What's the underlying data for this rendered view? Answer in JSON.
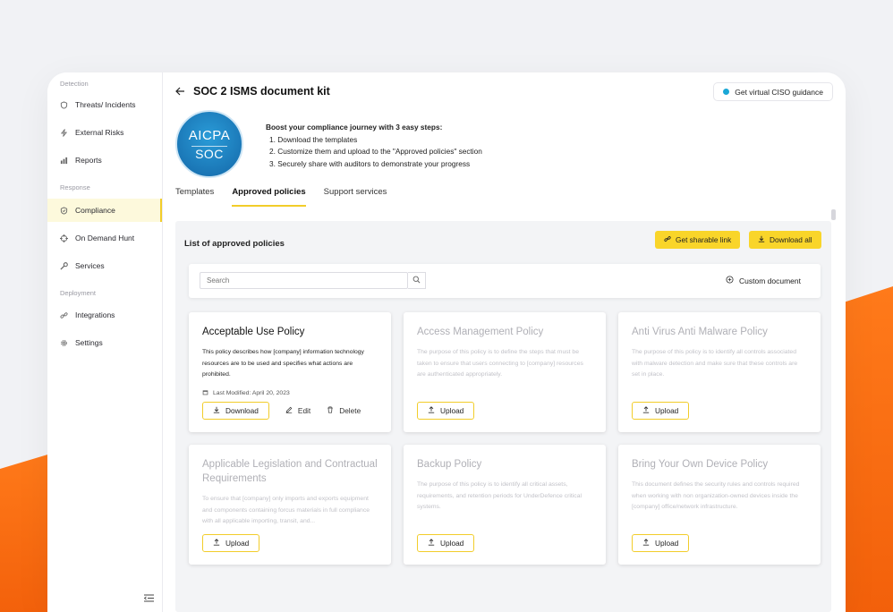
{
  "sidebar": {
    "sections": [
      {
        "label": "Detection",
        "items": [
          {
            "label": "Threats/ Incidents",
            "icon": "shield-icon"
          },
          {
            "label": "External Risks",
            "icon": "bolt-icon"
          },
          {
            "label": "Reports",
            "icon": "chart-icon"
          }
        ]
      },
      {
        "label": "Response",
        "items": [
          {
            "label": "Compliance",
            "icon": "check-shield-icon",
            "active": true
          },
          {
            "label": "On Demand Hunt",
            "icon": "crosshair-icon"
          },
          {
            "label": "Services",
            "icon": "wrench-icon"
          }
        ]
      },
      {
        "label": "Deployment",
        "items": [
          {
            "label": "Integrations",
            "icon": "link-icon"
          },
          {
            "label": "Settings",
            "icon": "gear-icon"
          }
        ]
      }
    ]
  },
  "header": {
    "title": "SOC 2 ISMS document kit",
    "ciso_label": "Get virtual CISO guidance"
  },
  "logo": {
    "line1": "AICPA",
    "line2": "SOC"
  },
  "steps": {
    "heading": "Boost your compliance journey with 3 easy steps:",
    "items": [
      "1. Download the templates",
      "2. Customize them and upload to the \"Approved policies\" section",
      "3. Securely share with auditors to demonstrate your progress"
    ]
  },
  "tabs": [
    "Templates",
    "Approved policies",
    "Support services"
  ],
  "list": {
    "title": "List of approved policies",
    "sharable_label": "Get sharable link",
    "download_all_label": "Download all",
    "search_placeholder": "Search",
    "custom_doc_label": "Custom document"
  },
  "cards": [
    {
      "title": "Acceptable Use Policy",
      "desc": "This policy describes how [company] information technology resources are to be used and specifies what actions are prohibited.",
      "modified": "Last Modified: April 20, 2023",
      "download": "Download",
      "edit": "Edit",
      "delete": "Delete",
      "disabled": false
    },
    {
      "title": "Access Management Policy",
      "desc": "The purpose of this policy is to define the steps that must be taken to ensure that users connecting to [company] resources are authenticated appropriately.",
      "upload": "Upload",
      "disabled": true
    },
    {
      "title": "Anti Virus Anti Malware Policy",
      "desc": "The purpose of this policy is to identify all controls associated with malware detection and make sure that these controls are set in place.",
      "upload": "Upload",
      "disabled": true
    },
    {
      "title": "Applicable Legislation and Contractual Requirements",
      "desc": "To ensure that [company] only imports and exports equipment and components containing forcus materials in full compliance with all applicable importing, transit, and...",
      "upload": "Upload",
      "disabled": true
    },
    {
      "title": "Backup Policy",
      "desc": "The purpose of this policy is to identify all critical assets, requirements, and retention periods for UnderDefence critical systems.",
      "upload": "Upload",
      "disabled": true
    },
    {
      "title": "Bring Your Own Device Policy",
      "desc": "This document defines the security rules and controls required when working with non organization-owned devices inside the [company] office/network infrastructure.",
      "upload": "Upload",
      "disabled": true
    }
  ]
}
